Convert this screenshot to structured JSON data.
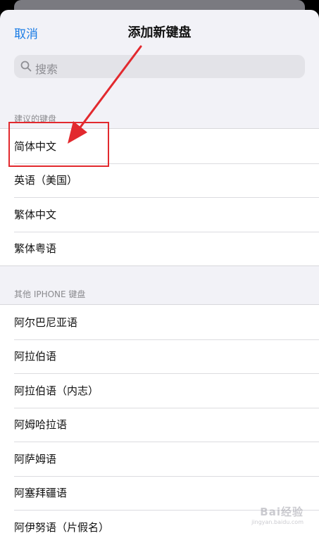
{
  "nav": {
    "cancel_label": "取消",
    "title": "添加新键盘"
  },
  "search": {
    "placeholder": "搜索"
  },
  "suggested": {
    "header": "建议的键盘",
    "items": [
      "简体中文",
      "英语（美国）",
      "繁体中文",
      "繁体粤语"
    ]
  },
  "other": {
    "header": "其他 IPHONE 键盘",
    "items": [
      "阿尔巴尼亚语",
      "阿拉伯语",
      "阿拉伯语（内志）",
      "阿姆哈拉语",
      "阿萨姆语",
      "阿塞拜疆语",
      "阿伊努语（片假名）"
    ]
  },
  "annotation": {
    "color": "#e2292e",
    "highlighted_item": "简体中文"
  },
  "watermark": {
    "main": "Bai经验",
    "sub": "jingyan.baidu.com"
  },
  "colors": {
    "accent": "#1a7ce5",
    "background": "#f2f2f7"
  }
}
